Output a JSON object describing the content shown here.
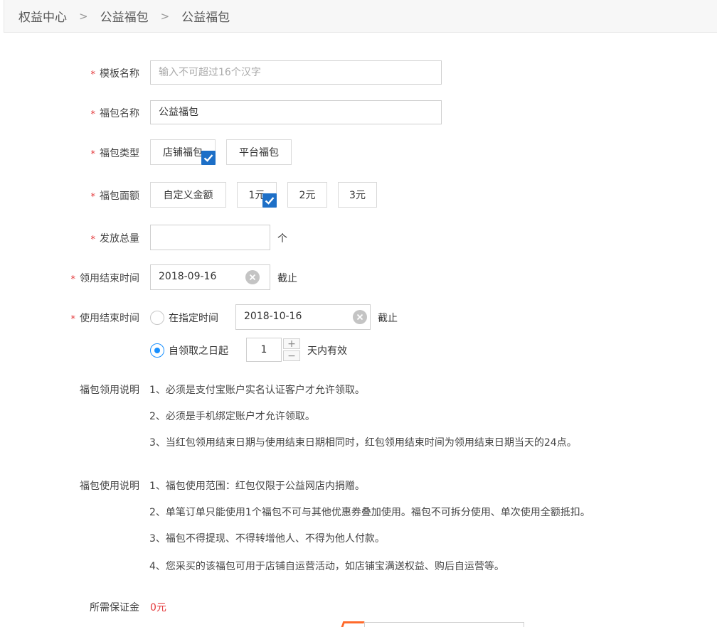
{
  "breadcrumb": [
    "权益中心",
    "公益福包",
    "公益福包"
  ],
  "breadcrumb_sep": ">",
  "form": {
    "template_name": {
      "label": "模板名称",
      "placeholder": "输入不可超过16个汉字"
    },
    "bag_name": {
      "label": "福包名称",
      "value": "公益福包"
    },
    "bag_type": {
      "label": "福包类型",
      "options": [
        "店铺福包",
        "平台福包"
      ],
      "selected": "店铺福包"
    },
    "bag_amount": {
      "label": "福包面额",
      "options": [
        "自定义金额",
        "1元",
        "2元",
        "3元"
      ],
      "selected": "1元"
    },
    "total_count": {
      "label": "发放总量",
      "value": "",
      "unit": "个"
    },
    "claim_end": {
      "label": "领用结束时间",
      "value": "2018-09-16",
      "suffix": "截止"
    },
    "use_end": {
      "label": "使用结束时间",
      "option_fixed": {
        "label": "在指定时间",
        "value": "2018-10-16",
        "suffix": "截止",
        "checked": false
      },
      "option_relative": {
        "label": "自领取之日起",
        "days": "1",
        "suffix": "天内有效",
        "checked": true
      },
      "plus": "+",
      "minus": "−"
    },
    "claim_desc": {
      "label": "福包领用说明",
      "lines": [
        "1、必须是支付宝账户实名认证客户才允许领取。",
        "2、必须是手机绑定账户才允许领取。",
        "3、当红包领用结束日期与使用结束日期相同时，红包领用结束时间为领用结束日期当天的24点。"
      ]
    },
    "use_desc": {
      "label": "福包使用说明",
      "lines": [
        "1、福包使用范围：红包仅限于公益网店内捐赠。",
        "2、单笔订单只能使用1个福包不可与其他优惠券叠加使用。福包不可拆分使用、单次使用全额抵扣。",
        "3、福包不得提现、不得转增他人、不得为他人付款。",
        "4、您采买的该福包可用于店铺自运营活动，如店铺宝满送权益、购后自运营等。"
      ]
    },
    "deposit": {
      "label": "所需保证金",
      "value": "0元"
    }
  },
  "required_mark": "*",
  "colors": {
    "accent": "#1d6fc7",
    "radio": "#1890ff",
    "required": "#e4393c"
  }
}
